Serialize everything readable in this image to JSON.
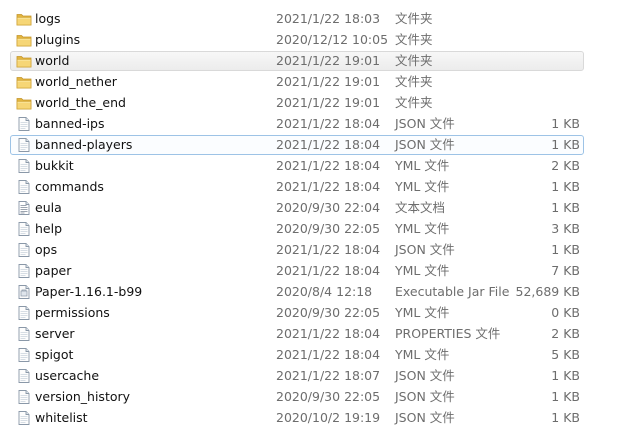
{
  "files": [
    {
      "name": "logs",
      "date": "2021/1/22 18:03",
      "type": "文件夹",
      "size": "",
      "icon": "folder-icon"
    },
    {
      "name": "plugins",
      "date": "2020/12/12 10:05",
      "type": "文件夹",
      "size": "",
      "icon": "folder-icon"
    },
    {
      "name": "world",
      "date": "2021/1/22 19:01",
      "type": "文件夹",
      "size": "",
      "icon": "folder-icon",
      "state": "hover"
    },
    {
      "name": "world_nether",
      "date": "2021/1/22 19:01",
      "type": "文件夹",
      "size": "",
      "icon": "folder-icon"
    },
    {
      "name": "world_the_end",
      "date": "2021/1/22 19:01",
      "type": "文件夹",
      "size": "",
      "icon": "folder-icon"
    },
    {
      "name": "banned-ips",
      "date": "2021/1/22 18:04",
      "type": "JSON 文件",
      "size": "1 KB",
      "icon": "document-icon"
    },
    {
      "name": "banned-players",
      "date": "2021/1/22 18:04",
      "type": "JSON 文件",
      "size": "1 KB",
      "icon": "document-icon",
      "state": "focused"
    },
    {
      "name": "bukkit",
      "date": "2021/1/22 18:04",
      "type": "YML 文件",
      "size": "2 KB",
      "icon": "document-icon"
    },
    {
      "name": "commands",
      "date": "2021/1/22 18:04",
      "type": "YML 文件",
      "size": "1 KB",
      "icon": "document-icon"
    },
    {
      "name": "eula",
      "date": "2020/9/30 22:04",
      "type": "文本文档",
      "size": "1 KB",
      "icon": "text-document-icon"
    },
    {
      "name": "help",
      "date": "2020/9/30 22:05",
      "type": "YML 文件",
      "size": "3 KB",
      "icon": "document-icon"
    },
    {
      "name": "ops",
      "date": "2021/1/22 18:04",
      "type": "JSON 文件",
      "size": "1 KB",
      "icon": "document-icon"
    },
    {
      "name": "paper",
      "date": "2021/1/22 18:04",
      "type": "YML 文件",
      "size": "7 KB",
      "icon": "document-icon"
    },
    {
      "name": "Paper-1.16.1-b99",
      "date": "2020/8/4 12:18",
      "type": "Executable Jar File",
      "size": "52,689 KB",
      "icon": "jar-file-icon"
    },
    {
      "name": "permissions",
      "date": "2020/9/30 22:05",
      "type": "YML 文件",
      "size": "0 KB",
      "icon": "document-icon"
    },
    {
      "name": "server",
      "date": "2021/1/22 18:04",
      "type": "PROPERTIES 文件",
      "size": "2 KB",
      "icon": "document-icon"
    },
    {
      "name": "spigot",
      "date": "2021/1/22 18:04",
      "type": "YML 文件",
      "size": "5 KB",
      "icon": "document-icon"
    },
    {
      "name": "usercache",
      "date": "2021/1/22 18:07",
      "type": "JSON 文件",
      "size": "1 KB",
      "icon": "document-icon"
    },
    {
      "name": "version_history",
      "date": "2020/9/30 22:05",
      "type": "JSON 文件",
      "size": "1 KB",
      "icon": "document-icon"
    },
    {
      "name": "whitelist",
      "date": "2020/10/2 19:19",
      "type": "JSON 文件",
      "size": "1 KB",
      "icon": "document-icon"
    }
  ]
}
